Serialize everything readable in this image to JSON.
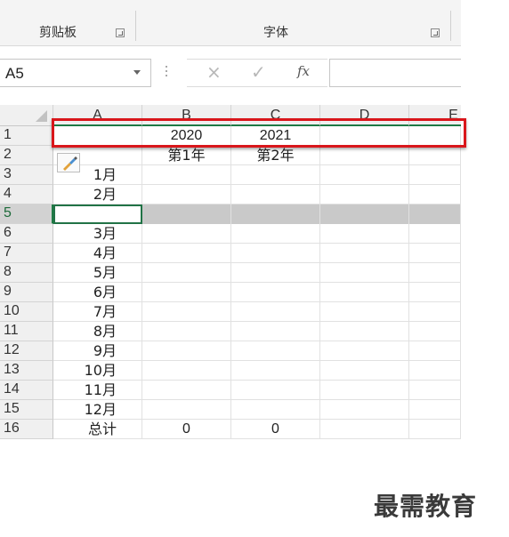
{
  "ribbon": {
    "groups": [
      {
        "label": "剪贴板"
      },
      {
        "label": "字体"
      }
    ]
  },
  "formula_bar": {
    "name_box": "A5",
    "cancel_icon": "cancel-x-icon",
    "enter_icon": "enter-check-icon",
    "function_label": "fx",
    "formula": ""
  },
  "columns": [
    "A",
    "B",
    "C",
    "D",
    "E"
  ],
  "rows": [
    {
      "num": "1",
      "a": "",
      "b": "2020",
      "c": "2021"
    },
    {
      "num": "2",
      "a": "",
      "b": "第1年",
      "c": "第2年"
    },
    {
      "num": "3",
      "a": "1月",
      "b": "",
      "c": ""
    },
    {
      "num": "4",
      "a": "2月",
      "b": "",
      "c": ""
    },
    {
      "num": "5",
      "a": "",
      "b": "",
      "c": ""
    },
    {
      "num": "6",
      "a": "3月",
      "b": "",
      "c": ""
    },
    {
      "num": "7",
      "a": "4月",
      "b": "",
      "c": ""
    },
    {
      "num": "8",
      "a": "5月",
      "b": "",
      "c": ""
    },
    {
      "num": "9",
      "a": "6月",
      "b": "",
      "c": ""
    },
    {
      "num": "10",
      "a": "7月",
      "b": "",
      "c": ""
    },
    {
      "num": "11",
      "a": "8月",
      "b": "",
      "c": ""
    },
    {
      "num": "12",
      "a": "9月",
      "b": "",
      "c": ""
    },
    {
      "num": "13",
      "a": "10月",
      "b": "",
      "c": ""
    },
    {
      "num": "14",
      "a": "11月",
      "b": "",
      "c": ""
    },
    {
      "num": "15",
      "a": "12月",
      "b": "",
      "c": ""
    },
    {
      "num": "16",
      "a": "总计",
      "b": "0",
      "c": "0"
    }
  ],
  "selected_row": "5",
  "highlight_color": "#d9161b",
  "accent_color": "#217346",
  "paste_options_icon": "paintbrush-icon",
  "watermark": "最需教育"
}
